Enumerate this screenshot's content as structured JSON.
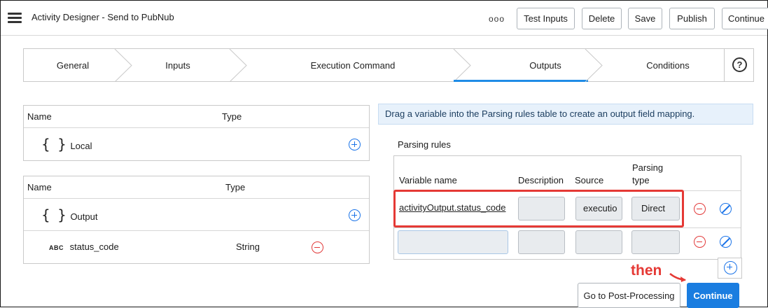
{
  "header": {
    "title": "Activity Designer - Send to PubNub",
    "more_label": "ooo",
    "buttons": {
      "test_inputs": "Test Inputs",
      "delete": "Delete",
      "save": "Save",
      "publish": "Publish",
      "continue": "Continue"
    }
  },
  "stepper": {
    "steps": [
      "General",
      "Inputs",
      "Execution Command",
      "Outputs",
      "Conditions"
    ],
    "active": "Outputs",
    "help_label": "?"
  },
  "local_table": {
    "col_name": "Name",
    "col_type": "Type",
    "rows": [
      {
        "name": "Local",
        "type": "",
        "icon": "braces-icon"
      }
    ]
  },
  "output_table": {
    "col_name": "Name",
    "col_type": "Type",
    "rows": [
      {
        "name": "Output",
        "type": "",
        "icon": "braces-icon"
      },
      {
        "name": "status_code",
        "type": "String",
        "icon": "abc-icon",
        "icon_text": "ABC"
      }
    ]
  },
  "info_message": "Drag a variable into the Parsing rules table to create an output field mapping.",
  "parsing": {
    "title": "Parsing rules",
    "headers": {
      "variable": "Variable name",
      "description": "Description",
      "source": "Source",
      "parsing_type_1": "Parsing",
      "parsing_type_2": "type"
    },
    "rows": [
      {
        "variable": "activityOutput.status_code",
        "description": "",
        "source": "executio",
        "parsing_type": "Direct"
      },
      {
        "variable": "",
        "description": "",
        "source": "",
        "parsing_type": ""
      }
    ]
  },
  "annotation": {
    "text": "then",
    "color": "#e53935"
  },
  "footer": {
    "post_processing": "Go to Post-Processing",
    "continue": "Continue"
  },
  "colors": {
    "accent": "#1f8ce6",
    "primary_button": "#1a7de0",
    "danger": "#e23a3a",
    "info_bg": "#e7f1fb"
  }
}
